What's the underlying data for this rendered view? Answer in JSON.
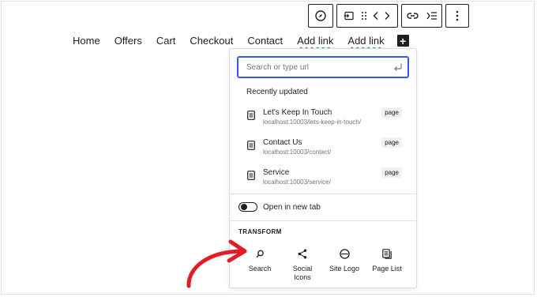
{
  "toolbar": {
    "groups": [
      {
        "items": [
          "compass-icon"
        ]
      },
      {
        "items": [
          "submenu-icon",
          "drag-handle-icon",
          "chevron-left-icon",
          "chevron-right-icon"
        ]
      },
      {
        "items": [
          "link-icon",
          "indent-icon"
        ]
      },
      {
        "items": [
          "more-vertical-icon"
        ]
      }
    ]
  },
  "nav": {
    "items": [
      {
        "label": "Home"
      },
      {
        "label": "Offers"
      },
      {
        "label": "Cart"
      },
      {
        "label": "Checkout"
      },
      {
        "label": "Contact"
      },
      {
        "label": "Add link"
      },
      {
        "label": "Add link"
      }
    ],
    "plus_label": "+"
  },
  "link_popover": {
    "search": {
      "placeholder": "Search or type url",
      "value": ""
    },
    "recent_title": "Recently updated",
    "results": [
      {
        "title": "Let's Keep In Touch",
        "url": "localhost:10003/lets-keep-in-touch/",
        "type": "page"
      },
      {
        "title": "Contact Us",
        "url": "localhost:10003/contact/",
        "type": "page"
      },
      {
        "title": "Service",
        "url": "localhost:10003/service/",
        "type": "page"
      }
    ],
    "new_tab": {
      "label": "Open in new tab",
      "checked": false
    },
    "transform": {
      "title": "TRANSFORM",
      "options": [
        {
          "label": "Search",
          "icon": "search-icon"
        },
        {
          "label": "Social Icons",
          "icon": "share-icon"
        },
        {
          "label": "Site Logo",
          "icon": "site-logo-icon"
        },
        {
          "label": "Page List",
          "icon": "page-list-icon"
        }
      ]
    }
  },
  "colors": {
    "accent": "#3858e9",
    "annotation_arrow": "#e01e28",
    "text": "#1e1e1e",
    "muted": "#757575"
  }
}
